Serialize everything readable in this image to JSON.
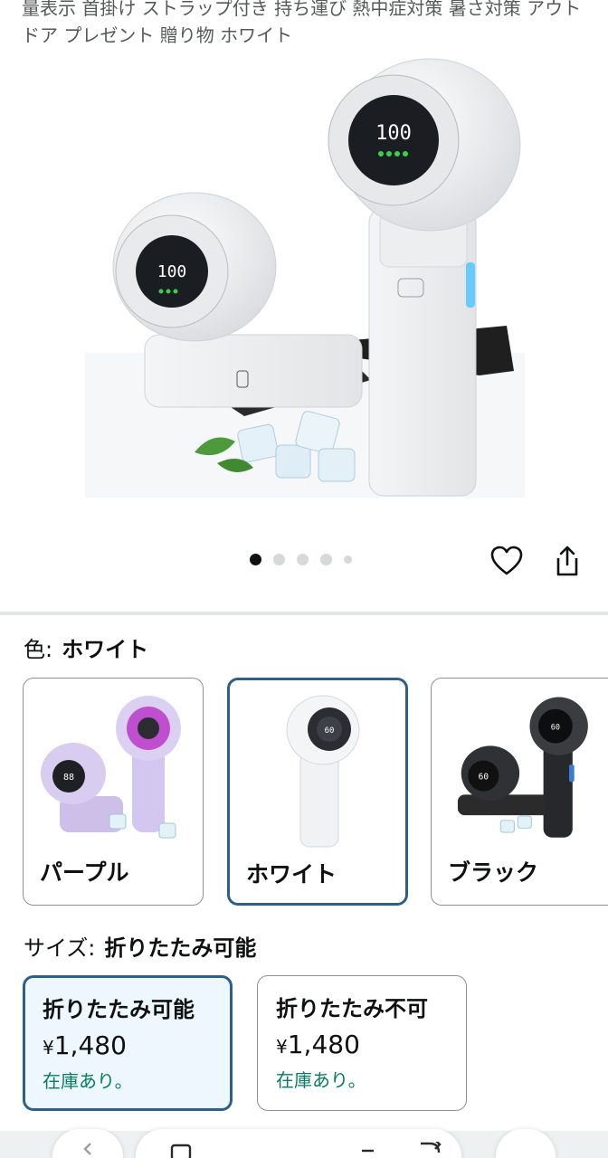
{
  "product": {
    "title": "量表示 首掛け ストラップ付き 持ち運び 熱中症対策 暑さ対策 アウトドア プレゼント 贈り物 ホワイト"
  },
  "gallery": {
    "dot_count": 5,
    "active_index": 0
  },
  "color": {
    "label": "色:",
    "selected": "ホワイト",
    "options": [
      {
        "name": "パープル",
        "selected": false
      },
      {
        "name": "ホワイト",
        "selected": true
      },
      {
        "name": "ブラック",
        "selected": false
      }
    ]
  },
  "size": {
    "label": "サイズ:",
    "selected": "折りたたみ可能",
    "options": [
      {
        "name": "折りたたみ可能",
        "currency": "¥",
        "price": "1,480",
        "stock": "在庫あり。",
        "selected": true
      },
      {
        "name": "折りたたみ不可",
        "currency": "¥",
        "price": "1,480",
        "stock": "在庫あり。",
        "selected": false
      }
    ]
  },
  "fan_display": "100",
  "colors": {
    "accent_border": "#2c5f8a",
    "stock_green": "#067d62",
    "selected_bg": "#edf7fd"
  }
}
